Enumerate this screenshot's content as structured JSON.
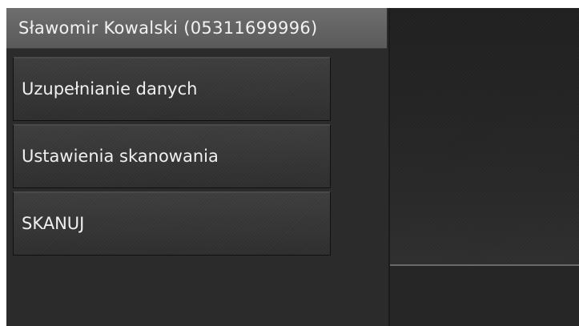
{
  "header": {
    "title": "Sławomir Kowalski (05311699996)"
  },
  "menu": {
    "items": [
      {
        "label": "Uzupełnianie danych"
      },
      {
        "label": "Ustawienia skanowania"
      },
      {
        "label": "SKANUJ"
      }
    ]
  },
  "colors": {
    "header_bg": "#5f5f5f",
    "panel_bg": "#2b2b2b",
    "button_bg": "#353535",
    "text": "#f0f0f0"
  }
}
